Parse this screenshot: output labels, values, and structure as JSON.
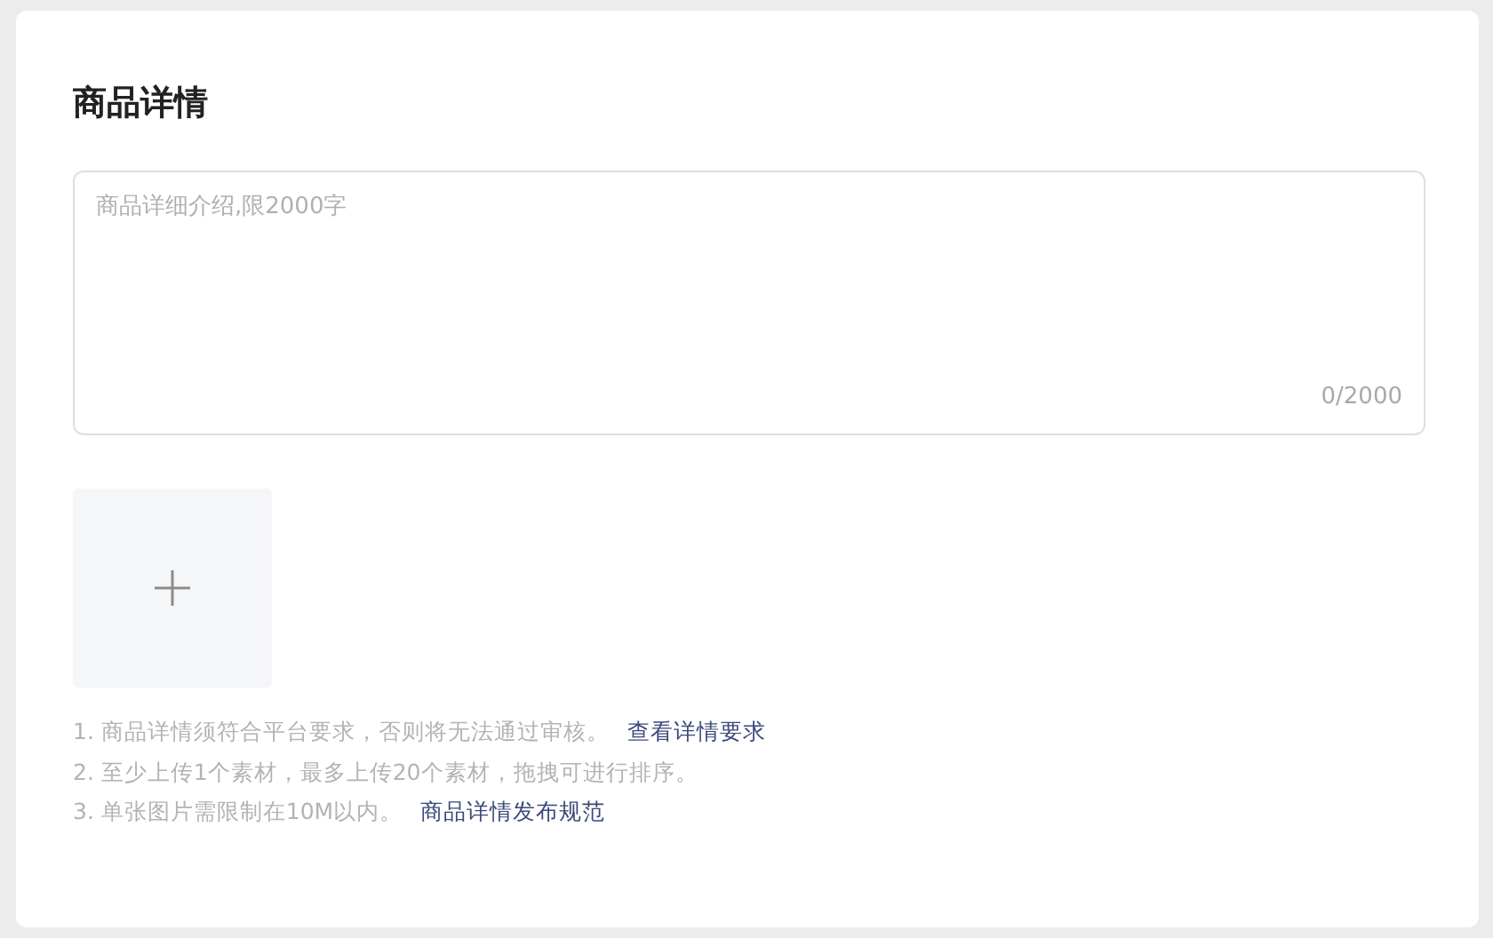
{
  "section": {
    "title": "商品详情"
  },
  "description": {
    "placeholder": "商品详细介绍,限2000字",
    "counter": "0/2000"
  },
  "notes": [
    {
      "text": "1. 商品详情须符合平台要求，否则将无法通过审核。",
      "link": "查看详情要求"
    },
    {
      "text": "2. 至少上传1个素材，最多上传20个素材，拖拽可进行排序。"
    },
    {
      "text": "3. 单张图片需限制在10M以内。",
      "link": "商品详情发布规范"
    }
  ]
}
